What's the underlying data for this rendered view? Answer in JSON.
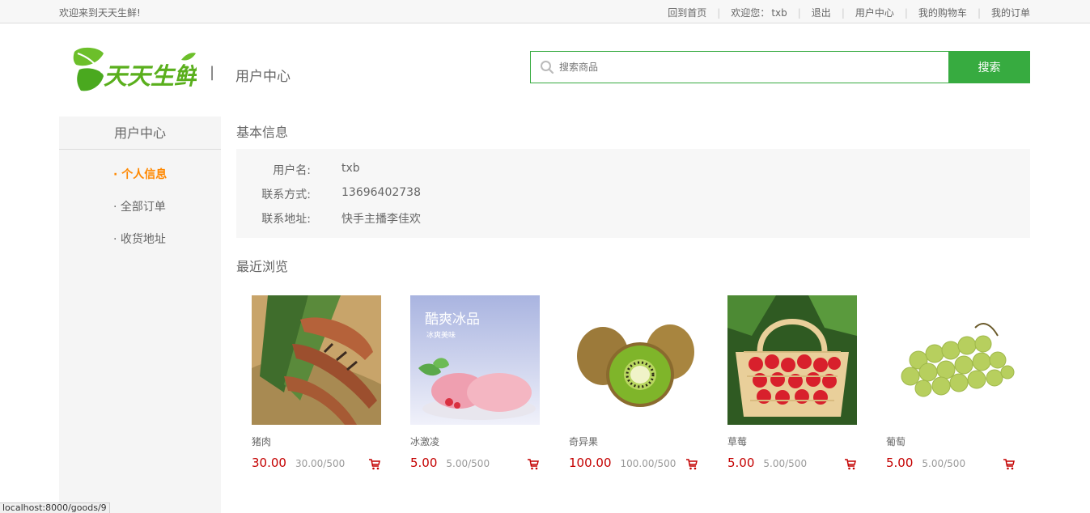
{
  "topbar": {
    "welcome": "欢迎来到天天生鲜!",
    "links": {
      "home": "回到首页",
      "greeting": "欢迎您：",
      "username": "txb",
      "logout": "退出",
      "user_center": "用户中心",
      "cart": "我的购物车",
      "orders": "我的订单"
    }
  },
  "header": {
    "logo_text": "天天生鲜",
    "divider": "|",
    "sub_title": "用户中心",
    "search": {
      "placeholder": "搜索商品",
      "button": "搜索"
    }
  },
  "sidebar": {
    "title": "用户中心",
    "items": [
      {
        "label": "· 个人信息",
        "active": true
      },
      {
        "label": "· 全部订单",
        "active": false
      },
      {
        "label": "· 收货地址",
        "active": false
      }
    ]
  },
  "main": {
    "info_title": "基本信息",
    "info": [
      {
        "label": "用户名:",
        "value": "txb"
      },
      {
        "label": "联系方式:",
        "value": "13696402738"
      },
      {
        "label": "联系地址:",
        "value": "快手主播李佳欢"
      }
    ],
    "recent_title": "最近浏览",
    "goods": [
      {
        "name": "猪肉",
        "price": "30.00",
        "unit": "30.00/500",
        "image": "shrimp"
      },
      {
        "name": "冰激凌",
        "price": "5.00",
        "unit": "5.00/500",
        "image": "ice-cream",
        "image_text": "酷爽冰品",
        "image_subtext": "冰爽美味"
      },
      {
        "name": "奇异果",
        "price": "100.00",
        "unit": "100.00/500",
        "image": "kiwi"
      },
      {
        "name": "草莓",
        "price": "5.00",
        "unit": "5.00/500",
        "image": "strawberry"
      },
      {
        "name": "葡萄",
        "price": "5.00",
        "unit": "5.00/500",
        "image": "grape"
      }
    ]
  },
  "status_url": "localhost:8000/goods/9",
  "colors": {
    "brand": "#37ab40",
    "price": "#c40000",
    "active": "#ff8800"
  }
}
